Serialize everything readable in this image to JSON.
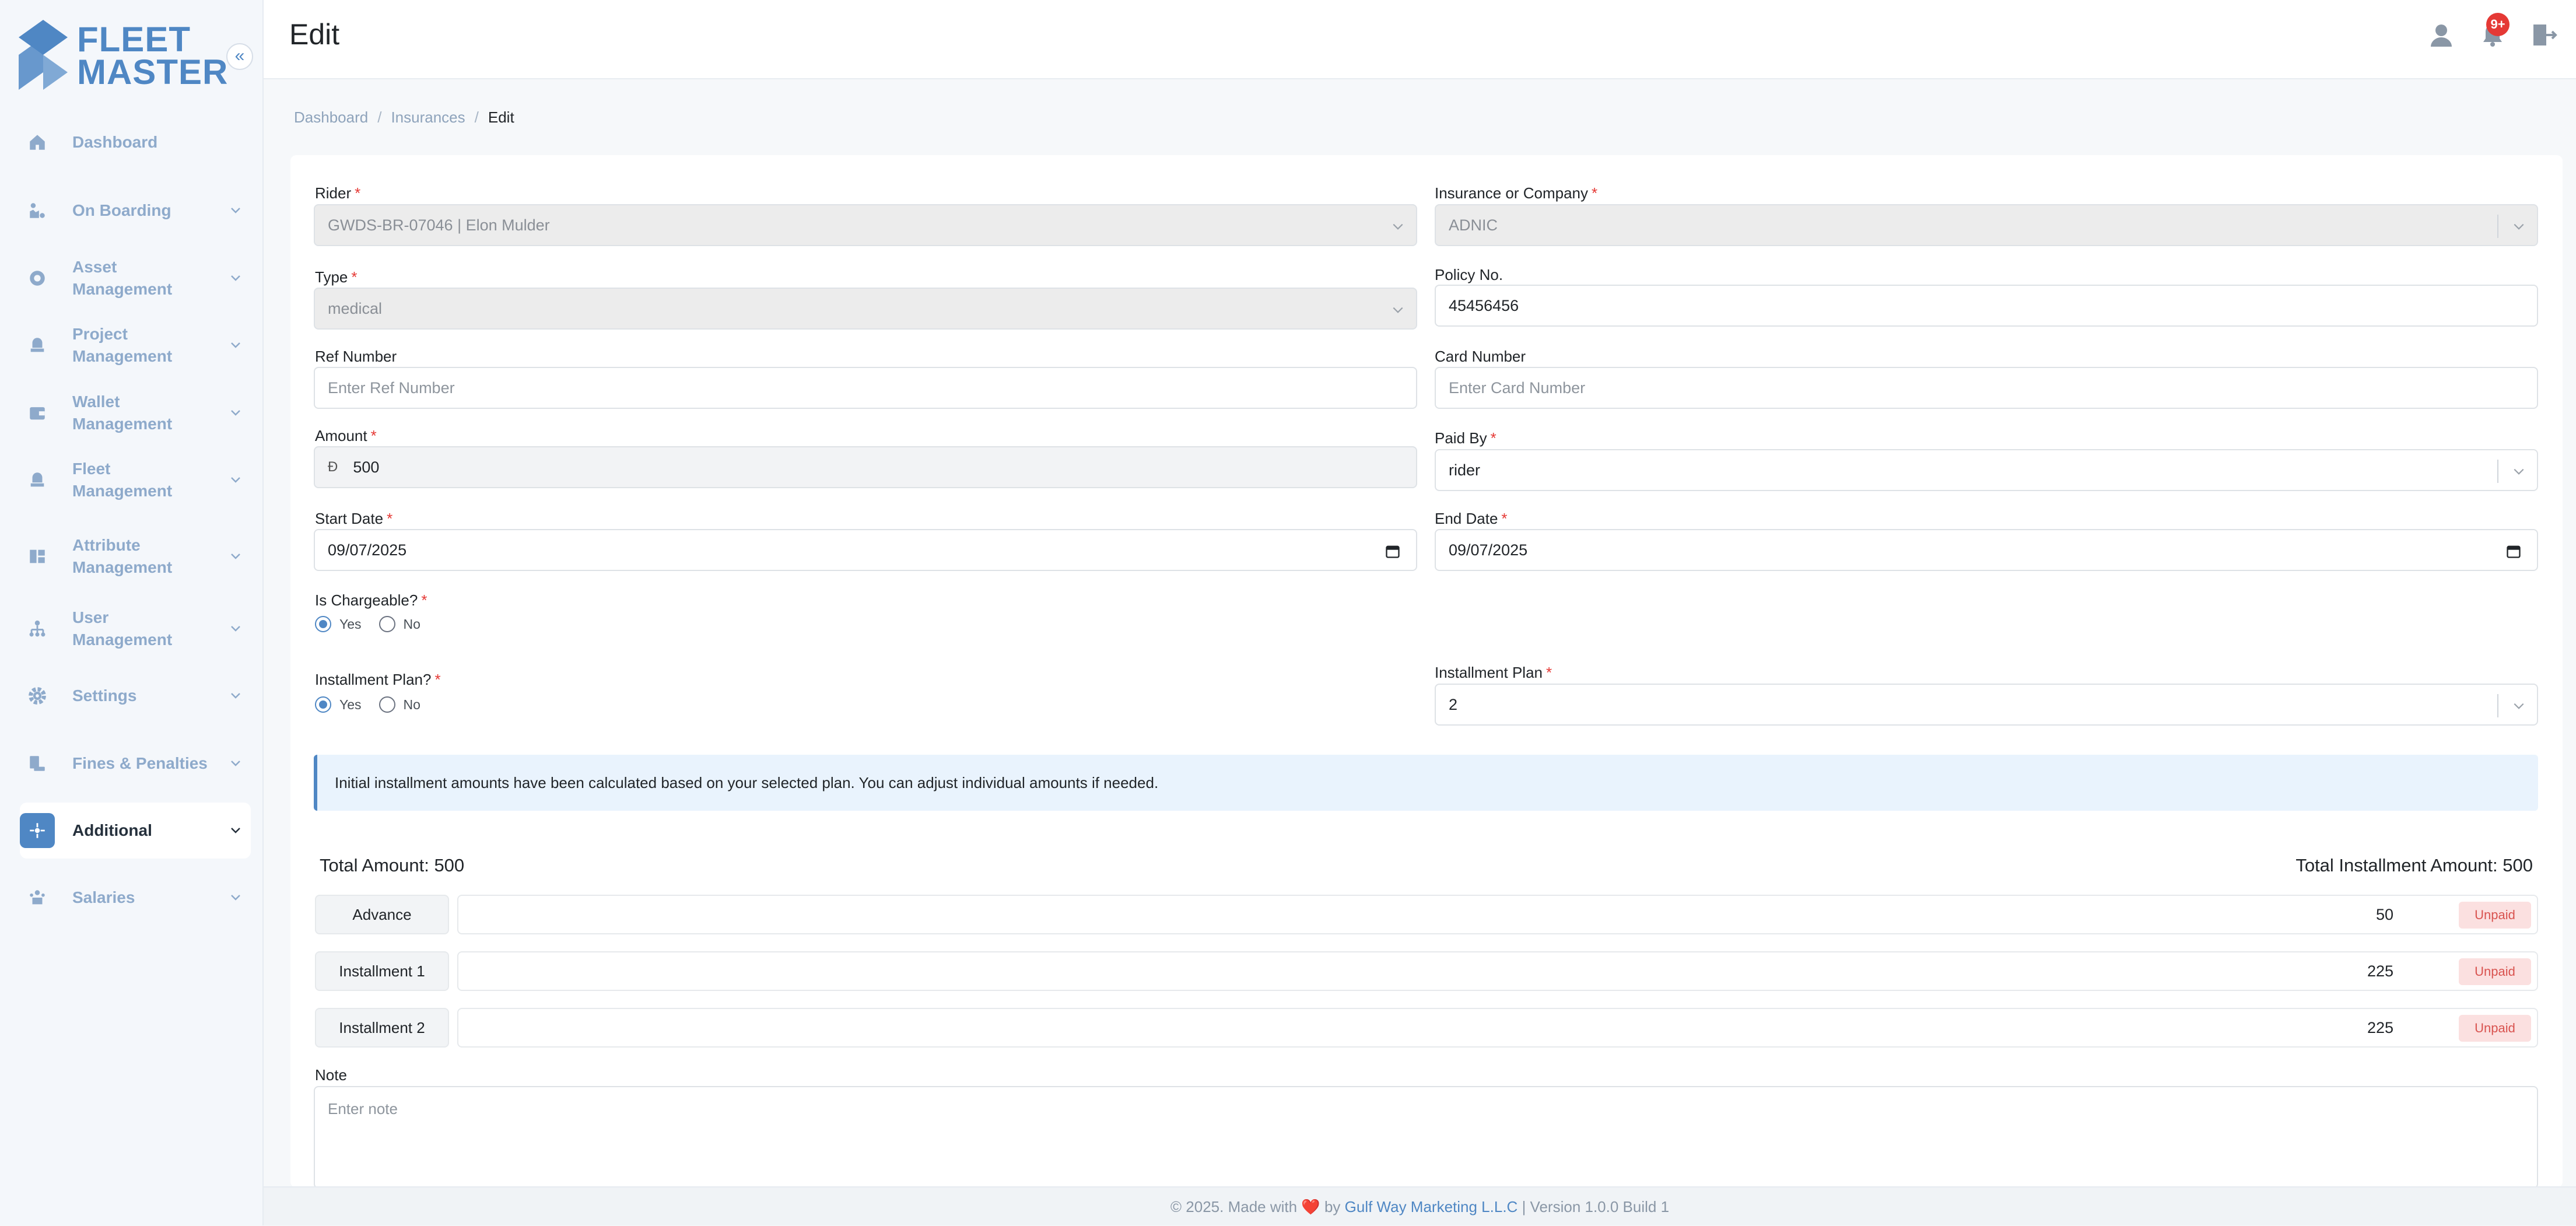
{
  "brand": {
    "line1": "FLEET",
    "line2": "MASTER",
    "color": "#4f87c4"
  },
  "sidebar": {
    "items": [
      {
        "label": "Dashboard",
        "icon": "home-icon"
      },
      {
        "label": "On Boarding",
        "icon": "onboarding-icon"
      },
      {
        "label": "Asset Management",
        "icon": "asset-icon"
      },
      {
        "label": "Project Management",
        "icon": "project-icon"
      },
      {
        "label": "Wallet Management",
        "icon": "wallet-icon"
      },
      {
        "label": "Fleet Management",
        "icon": "fleet-icon"
      },
      {
        "label": "Attribute Management",
        "icon": "attribute-icon"
      },
      {
        "label": "User Management",
        "icon": "users-icon"
      },
      {
        "label": "Settings",
        "icon": "gear-icon"
      },
      {
        "label": "Fines & Penalties",
        "icon": "fines-icon"
      },
      {
        "label": "Additional",
        "icon": "additional-icon",
        "active": true
      },
      {
        "label": "Salaries",
        "icon": "salaries-icon"
      }
    ]
  },
  "header": {
    "title": "Edit",
    "notification_badge": "9+"
  },
  "breadcrumb": {
    "items": [
      "Dashboard",
      "Insurances",
      "Edit"
    ]
  },
  "form": {
    "rider": {
      "label": "Rider",
      "value": "GWDS-BR-07046 | Elon Mulder"
    },
    "company": {
      "label": "Insurance or Company",
      "value": "ADNIC"
    },
    "type": {
      "label": "Type",
      "value": "medical"
    },
    "policy": {
      "label": "Policy No.",
      "value": "45456456"
    },
    "ref": {
      "label": "Ref Number",
      "placeholder": "Enter Ref Number"
    },
    "card": {
      "label": "Card Number",
      "placeholder": "Enter Card Number"
    },
    "amount": {
      "label": "Amount",
      "currency": "Đ",
      "value": "500"
    },
    "paid_by": {
      "label": "Paid By",
      "value": "rider"
    },
    "start_date": {
      "label": "Start Date",
      "value": "09/07/2025"
    },
    "end_date": {
      "label": "End Date",
      "value": "09/07/2025"
    },
    "chargeable": {
      "label": "Is Chargeable?",
      "yes": "Yes",
      "no": "No",
      "selected": "Yes"
    },
    "installment_plan_q": {
      "label": "Installment Plan?",
      "yes": "Yes",
      "no": "No",
      "selected": "Yes"
    },
    "installment_plan": {
      "label": "Installment Plan",
      "value": "2"
    },
    "required_mark": "*"
  },
  "alert": {
    "text": "Initial installment amounts have been calculated based on your selected plan. You can adjust individual amounts if needed."
  },
  "totals": {
    "total_amount": "Total Amount: 500",
    "total_installment": "Total Installment Amount: 500"
  },
  "installments": [
    {
      "label": "Advance",
      "amount": "50",
      "status": "Unpaid"
    },
    {
      "label": "Installment 1",
      "amount": "225",
      "status": "Unpaid"
    },
    {
      "label": "Installment 2",
      "amount": "225",
      "status": "Unpaid"
    }
  ],
  "note": {
    "label": "Note",
    "placeholder": "Enter note"
  },
  "footer": {
    "prefix": "© 2025. Made with",
    "heart": "❤️",
    "by": "by",
    "company": "Gulf Way Marketing L.L.C",
    "suffix": "| Version 1.0.0 Build 1"
  }
}
